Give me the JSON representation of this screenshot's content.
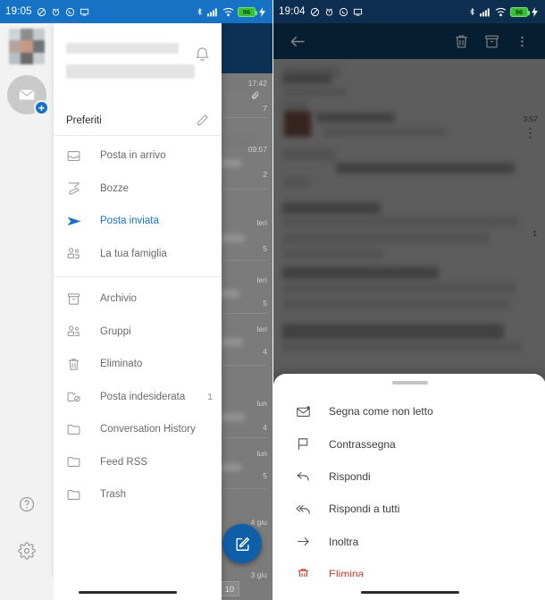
{
  "left_phone": {
    "status_bar": {
      "time": "19:05",
      "icons": [
        "mute-icon",
        "alarm-icon",
        "whatsapp-icon",
        "screencast-icon"
      ],
      "right_icons": [
        "bluetooth-icon",
        "signal-icon",
        "wifi-icon"
      ],
      "battery_level": "96",
      "bar_color": "#1572c4"
    },
    "rail": {
      "avatar_name": "account-avatar",
      "add_account_label": "+",
      "help_label": "?",
      "settings_name": "settings-gear"
    },
    "drawer": {
      "notification_icon": "bell-icon",
      "favorites_label": "Preferiti",
      "favorites_edit_icon": "pencil-icon",
      "items": [
        {
          "label": "Posta in arrivo",
          "icon": "inbox-icon",
          "count": "",
          "active": false
        },
        {
          "label": "Bozze",
          "icon": "drafts-pencil-icon",
          "count": "",
          "active": false
        },
        {
          "label": "Posta inviata",
          "icon": "sent-plane-icon",
          "count": "",
          "active": true
        },
        {
          "label": "La tua famiglia",
          "icon": "group-icon",
          "count": "",
          "active": false
        }
      ],
      "items2": [
        {
          "label": "Archivio",
          "icon": "archive-icon",
          "count": "",
          "active": false
        },
        {
          "label": "Gruppi",
          "icon": "group-icon",
          "count": "",
          "active": false
        },
        {
          "label": "Eliminato",
          "icon": "trash-icon",
          "count": "",
          "active": false
        },
        {
          "label": "Posta indesiderata",
          "icon": "junk-folder-icon",
          "count": "1",
          "active": false
        },
        {
          "label": "Conversation History",
          "icon": "folder-icon",
          "count": "",
          "active": false
        },
        {
          "label": "Feed RSS",
          "icon": "folder-icon",
          "count": "",
          "active": false
        },
        {
          "label": "Trash",
          "icon": "folder-icon",
          "count": "",
          "active": false
        }
      ]
    },
    "mail_list": {
      "compose_fab_icon": "compose-icon",
      "page_badge": "10",
      "rows": [
        {
          "time": "17:42",
          "count": "7",
          "attachment": true
        },
        {
          "time": "09:57",
          "count": "2",
          "attachment": false
        },
        {
          "time": "Ieri",
          "count": "5",
          "attachment": false
        },
        {
          "time": "Ieri",
          "count": "5",
          "attachment": false
        },
        {
          "time": "Ieri",
          "count": "4",
          "attachment": false
        },
        {
          "time": "lun",
          "count": "4",
          "attachment": false
        },
        {
          "time": "lun",
          "count": "5",
          "attachment": false
        },
        {
          "time": "4 giu",
          "count": "",
          "attachment": false
        },
        {
          "time": "3 giu",
          "count": "",
          "attachment": false
        }
      ]
    }
  },
  "right_phone": {
    "status_bar": {
      "time": "19:04",
      "icons": [
        "mute-icon",
        "alarm-icon",
        "whatsapp-icon",
        "screencast-icon"
      ],
      "right_icons": [
        "bluetooth-icon",
        "signal-icon",
        "wifi-icon"
      ],
      "battery_level": "96",
      "bar_color": "#0d2e4f"
    },
    "toolbar": {
      "back_icon": "back-arrow-icon",
      "delete_icon": "trash-icon",
      "archive_icon": "archive-icon",
      "overflow_icon": "more-vertical-icon"
    },
    "message": {
      "timestamp": "3:57",
      "counter": "1"
    },
    "bottom_sheet": {
      "grabber": "sheet-grabber",
      "items": [
        {
          "label": "Segna come non letto",
          "icon": "mark-unread-icon",
          "danger": false
        },
        {
          "label": "Contrassegna",
          "icon": "flag-icon",
          "danger": false
        },
        {
          "label": "Rispondi",
          "icon": "reply-icon",
          "danger": false
        },
        {
          "label": "Rispondi a tutti",
          "icon": "reply-all-icon",
          "danger": false
        },
        {
          "label": "Inoltra",
          "icon": "forward-arrow-icon",
          "danger": false
        },
        {
          "label": "Elimina",
          "icon": "trash-icon",
          "danger": true
        }
      ]
    }
  },
  "colors": {
    "accent_blue": "#1572c4",
    "toolbar_navy": "#0d3154",
    "danger_red": "#c0392b",
    "fab_blue": "#0f5ea8"
  }
}
